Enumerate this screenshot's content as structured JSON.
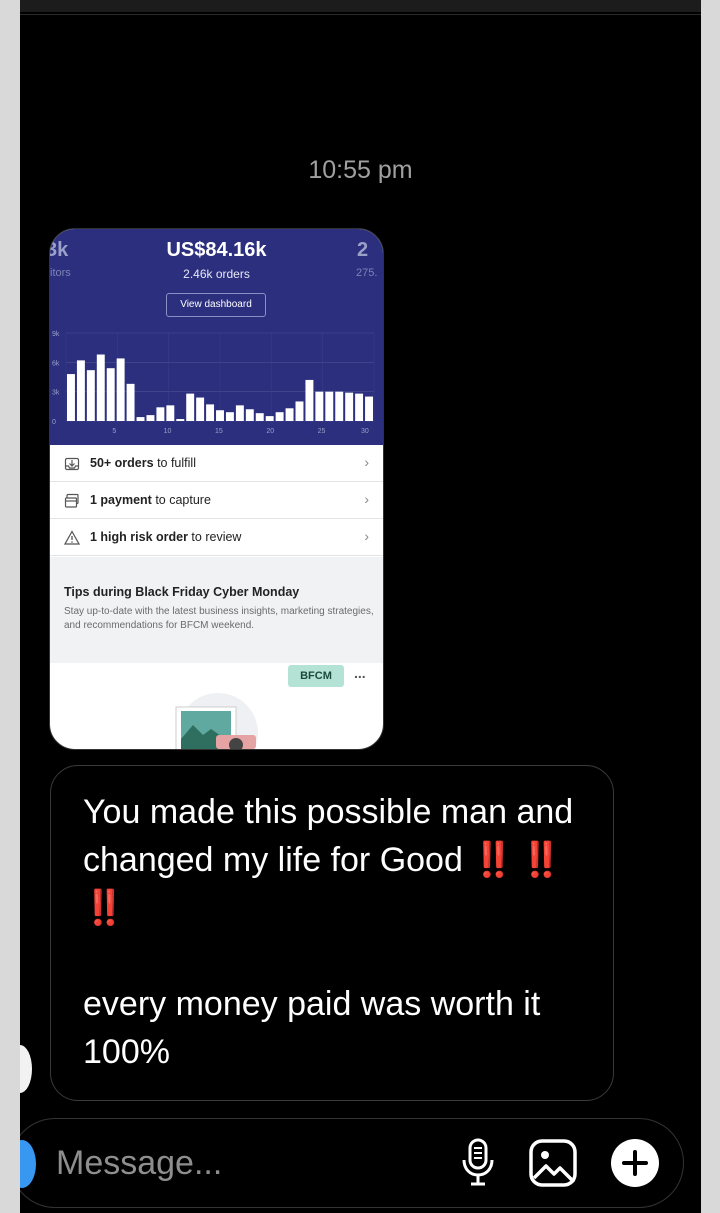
{
  "thread": {
    "timestamp": "10:55 pm"
  },
  "shared_screenshot": {
    "kpi_left_value": "3k",
    "kpi_left_sub": "itors",
    "kpi_main_value": "US$84.16k",
    "kpi_main_sub": "2.46k orders",
    "kpi_right_value": "2",
    "kpi_right_sub": "275.",
    "dashboard_button": "View dashboard",
    "chart_data": {
      "type": "bar",
      "ylim": [
        0,
        9000
      ],
      "y_ticks": [
        "9k",
        "6k",
        "3k",
        "0"
      ],
      "x_ticks": [
        "5",
        "10",
        "15",
        "20",
        "25",
        "30"
      ],
      "values": [
        4800,
        6200,
        5200,
        6800,
        5400,
        6400,
        3800,
        400,
        600,
        1400,
        1600,
        200,
        2800,
        2400,
        1700,
        1100,
        900,
        1600,
        1200,
        800,
        500,
        900,
        1300,
        2000,
        4200,
        3000,
        3000,
        3000,
        2900,
        2800,
        2500
      ],
      "bar_color": "#ffffff"
    },
    "tasks": [
      {
        "bold": "50+ orders",
        "rest": " to fulfill",
        "icon": "fulfill-icon",
        "chevron": "›"
      },
      {
        "bold": "1 payment",
        "rest": " to capture",
        "icon": "payment-icon",
        "chevron": "›"
      },
      {
        "bold": "1 high risk order",
        "rest": " to review",
        "icon": "warning-icon",
        "chevron": "›"
      }
    ],
    "tips_title": "Tips during Black Friday Cyber Monday",
    "tips_body": "Stay up-to-date with the latest business insights, marketing strategies, and recommendations for BFCM weekend.",
    "badge": "BFCM",
    "more": "..."
  },
  "message": {
    "line1": "You made this possible man and changed my life for Good ",
    "emphasis": "‼️ ‼️ ‼️",
    "line2": "every money paid was worth it 100%"
  },
  "composer": {
    "placeholder": "Message...",
    "icons": [
      "microphone-icon",
      "gallery-icon",
      "plus-icon"
    ]
  },
  "colors": {
    "background": "#000000",
    "dashboard_header": "#2b2f7e",
    "badge": "#b4e3d6",
    "exclamation": "#e02424"
  }
}
